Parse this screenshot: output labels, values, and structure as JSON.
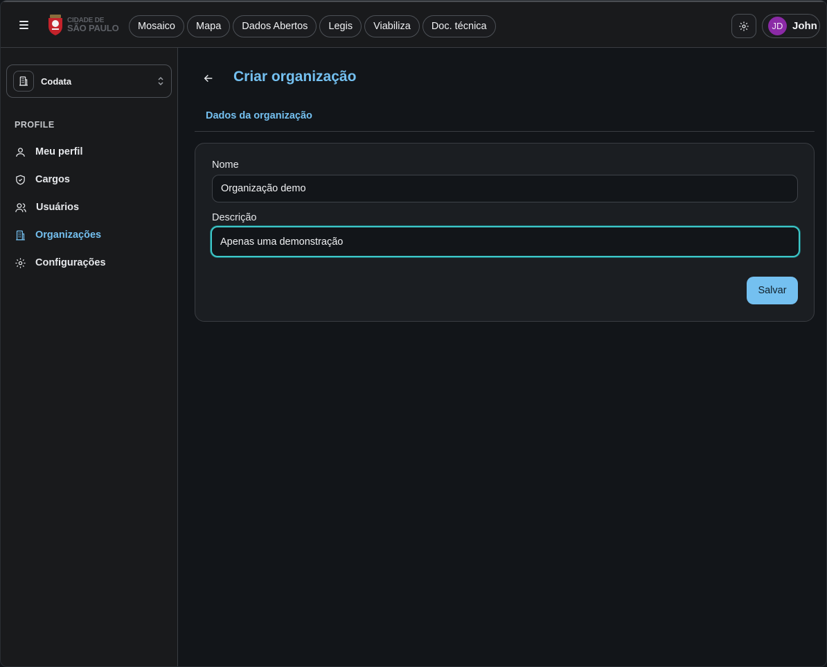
{
  "header": {
    "logo": {
      "line1": "CIDADE DE",
      "line2": "SÃO PAULO"
    },
    "nav": [
      "Mosaico",
      "Mapa",
      "Dados Abertos",
      "Legis",
      "Viabiliza",
      "Doc. técnica"
    ],
    "user": {
      "initials": "JD",
      "name": "John"
    }
  },
  "sidebar": {
    "organization": "Codata",
    "section_label": "PROFILE",
    "items": [
      {
        "label": "Meu perfil",
        "icon": "user-icon"
      },
      {
        "label": "Cargos",
        "icon": "shield-icon"
      },
      {
        "label": "Usuários",
        "icon": "users-icon"
      },
      {
        "label": "Organizações",
        "icon": "building-icon",
        "active": true
      },
      {
        "label": "Configurações",
        "icon": "gear-icon"
      }
    ]
  },
  "main": {
    "title": "Criar organização",
    "tab": "Dados da organização",
    "form": {
      "name_label": "Nome",
      "name_value": "Organização demo",
      "description_label": "Descrição",
      "description_value": "Apenas uma demonstração",
      "save_label": "Salvar"
    }
  },
  "colors": {
    "accent": "#74c0f0",
    "focus": "#3ec7c9",
    "avatar": "#8b2aa6"
  }
}
